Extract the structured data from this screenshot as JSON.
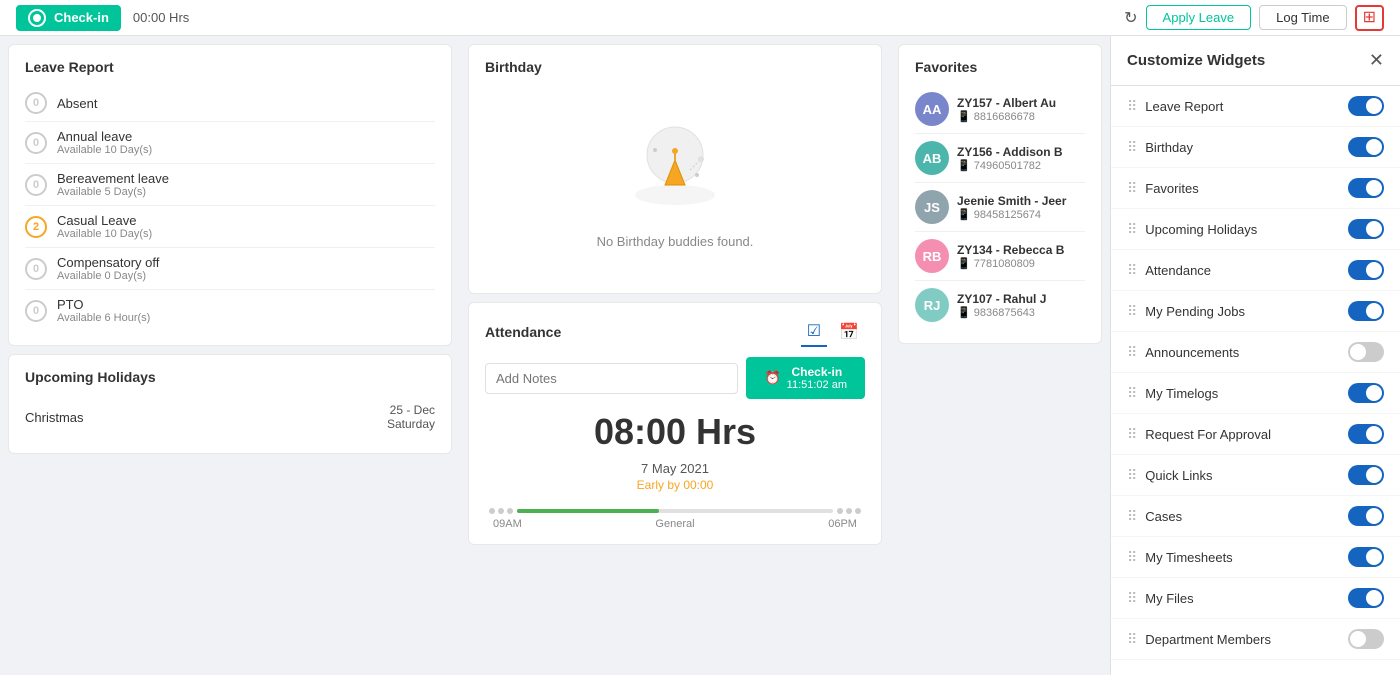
{
  "topbar": {
    "checkin_label": "Check-in",
    "timer": "00:00 Hrs",
    "apply_leave": "Apply Leave",
    "log_time": "Log Time"
  },
  "leave_report": {
    "title": "Leave Report",
    "items": [
      {
        "name": "Absent",
        "available": "",
        "count": "0",
        "badge_color": "zero"
      },
      {
        "name": "Annual leave",
        "available": "Available 10 Day(s)",
        "count": "0",
        "badge_color": "zero"
      },
      {
        "name": "Bereavement leave",
        "available": "Available 5 Day(s)",
        "count": "0",
        "badge_color": "zero"
      },
      {
        "name": "Casual Leave",
        "available": "Available 10 Day(s)",
        "count": "2",
        "badge_color": "two"
      },
      {
        "name": "Compensatory off",
        "available": "Available 0 Day(s)",
        "count": "0",
        "badge_color": "zero"
      },
      {
        "name": "PTO",
        "available": "Available 6 Hour(s)",
        "count": "0",
        "badge_color": "zero"
      }
    ]
  },
  "upcoming_holidays": {
    "title": "Upcoming Holidays",
    "items": [
      {
        "name": "Christmas",
        "date": "25 - Dec",
        "day": "Saturday"
      }
    ]
  },
  "birthday": {
    "title": "Birthday",
    "empty_message": "No Birthday buddies found."
  },
  "attendance": {
    "title": "Attendance",
    "notes_placeholder": "Add Notes",
    "checkin_btn": "Check-in",
    "checkin_time": "11:51:02 am",
    "hours": "08:00 Hrs",
    "date": "7 May 2021",
    "early": "Early by 00:00",
    "timeline_start": "09AM",
    "timeline_label": "General",
    "timeline_end": "06PM",
    "fill_percent": 45
  },
  "favorites": {
    "title": "Favorites",
    "items": [
      {
        "id": "ZY157",
        "name": "Albert Au",
        "phone": "8816686678",
        "initials": "AA",
        "color": "#7986cb"
      },
      {
        "id": "ZY156",
        "name": "Addison B",
        "phone": "74960501782",
        "initials": "AB",
        "color": "#4db6ac"
      },
      {
        "id": "",
        "name": "Jeenie Smith - Jeer",
        "phone": "98458125674",
        "initials": "JS",
        "color": "#90a4ae"
      },
      {
        "id": "ZY134",
        "name": "Rebecca B",
        "phone": "7781080809",
        "initials": "RB",
        "color": "#f48fb1"
      },
      {
        "id": "ZY107",
        "name": "Rahul J",
        "phone": "9836875643",
        "initials": "RJ",
        "color": "#80cbc4"
      }
    ]
  },
  "customize": {
    "title": "Customize Widgets",
    "widgets": [
      {
        "label": "Leave Report",
        "on": true
      },
      {
        "label": "Birthday",
        "on": true
      },
      {
        "label": "Favorites",
        "on": true
      },
      {
        "label": "Upcoming Holidays",
        "on": true
      },
      {
        "label": "Attendance",
        "on": true
      },
      {
        "label": "My Pending Jobs",
        "on": true
      },
      {
        "label": "Announcements",
        "on": false
      },
      {
        "label": "My Timelogs",
        "on": true
      },
      {
        "label": "Request For Approval",
        "on": true
      },
      {
        "label": "Quick Links",
        "on": true
      },
      {
        "label": "Cases",
        "on": true
      },
      {
        "label": "My Timesheets",
        "on": true
      },
      {
        "label": "My Files",
        "on": true
      },
      {
        "label": "Department Members",
        "on": false
      }
    ]
  }
}
